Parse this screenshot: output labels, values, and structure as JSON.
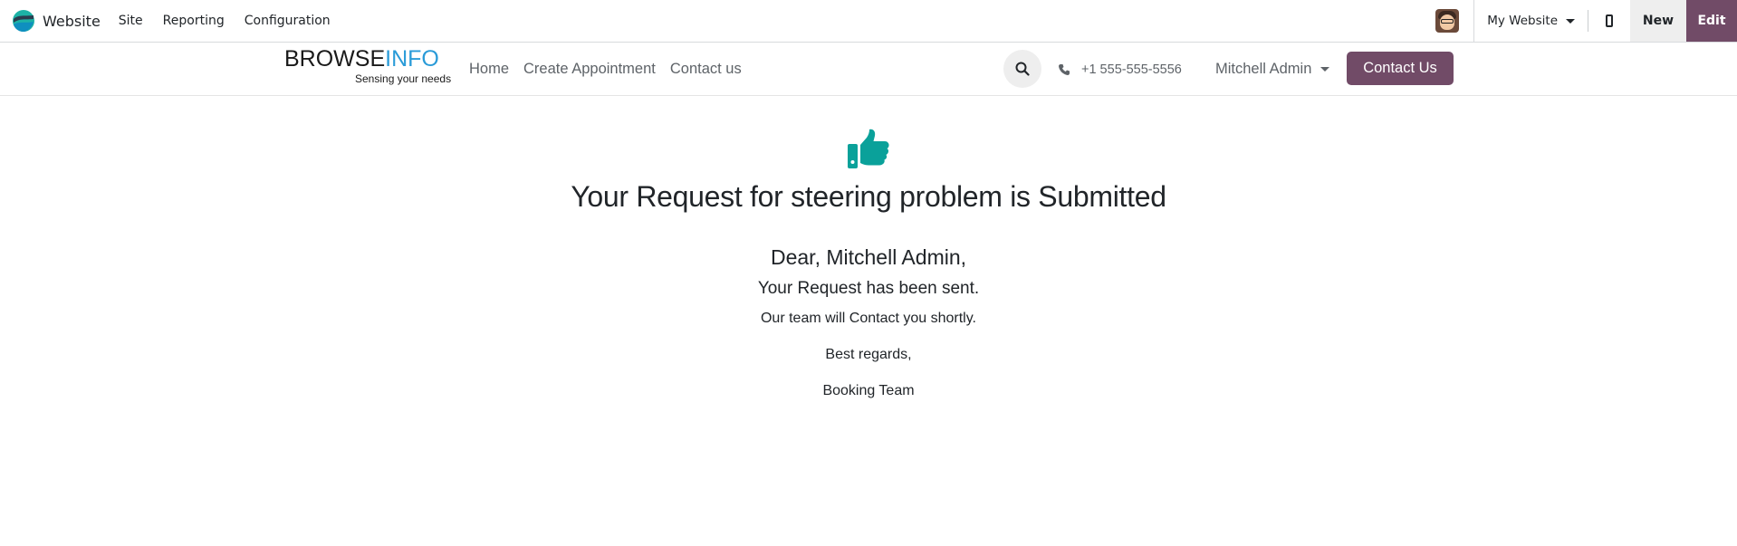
{
  "adminbar": {
    "app_name": "Website",
    "menu": [
      "Site",
      "Reporting",
      "Configuration"
    ],
    "website_selector": "My Website",
    "new_label": "New",
    "edit_label": "Edit",
    "accent_color": "#714b67"
  },
  "site_header": {
    "brand": {
      "part1": "BROWSE",
      "part2": "INFO",
      "tagline": "Sensing your needs"
    },
    "nav": [
      "Home",
      "Create Appointment",
      "Contact us"
    ],
    "search_icon": "search-icon",
    "phone": "+1 555-555-5556",
    "user": "Mitchell Admin",
    "contact_button": "Contact Us"
  },
  "confirmation": {
    "icon": "thumbs-up-icon",
    "icon_color": "#0aa19a",
    "title": "Your Request for steering problem is Submitted",
    "greeting": "Dear, Mitchell Admin,",
    "sent": "Your Request has been sent.",
    "followup": "Our team will Contact you shortly.",
    "regards": "Best regards,",
    "signature": "Booking Team"
  }
}
